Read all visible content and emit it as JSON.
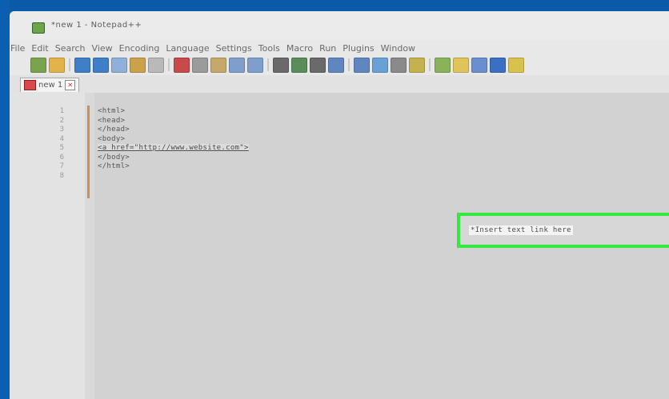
{
  "window": {
    "title": "*new 1 - Notepad++"
  },
  "menu": [
    "File",
    "Edit",
    "Search",
    "View",
    "Encoding",
    "Language",
    "Settings",
    "Tools",
    "Macro",
    "Run",
    "Plugins",
    "Window"
  ],
  "toolbar": {
    "buttons": [
      "new",
      "open",
      "save",
      "save-all",
      "close",
      "close-all",
      "print",
      "cut",
      "copy",
      "paste",
      "undo",
      "redo",
      "find",
      "replace",
      "zoom-in",
      "zoom-out",
      "sync-v",
      "sync-h",
      "wrap",
      "show-all",
      "indent-guide",
      "doc-map",
      "function-list",
      "folder-workspace",
      "monitor"
    ],
    "colors": [
      "#7aa34f",
      "#e0b44a",
      "#3f7fc7",
      "#3f7fc7",
      "#8fb0d8",
      "#c9a24a",
      "#b9b9b9",
      "#c74b4b",
      "#9b9b9b",
      "#c5a86c",
      "#7e9fcc",
      "#7e9fcc",
      "#6a6a6a",
      "#5a8d5a",
      "#6a6a6a",
      "#5f86bf",
      "#5f86bf",
      "#6aa0d6",
      "#8a8a8a",
      "#c3b24f",
      "#89b35a",
      "#e1c35c",
      "#6a8fcf",
      "#3a6fc4",
      "#d7c24e"
    ]
  },
  "tab": {
    "label": "new 1"
  },
  "editor": {
    "line_numbers": [
      "1",
      "2",
      "3",
      "4",
      "5",
      "6",
      "7",
      "8"
    ],
    "lines": [
      "<html>",
      "<head>",
      "</head>",
      "<body>",
      "<a href=\"http://www.website.com\">",
      "</body>",
      "</html>",
      ""
    ],
    "highlight_text": "*Insert text link here"
  }
}
